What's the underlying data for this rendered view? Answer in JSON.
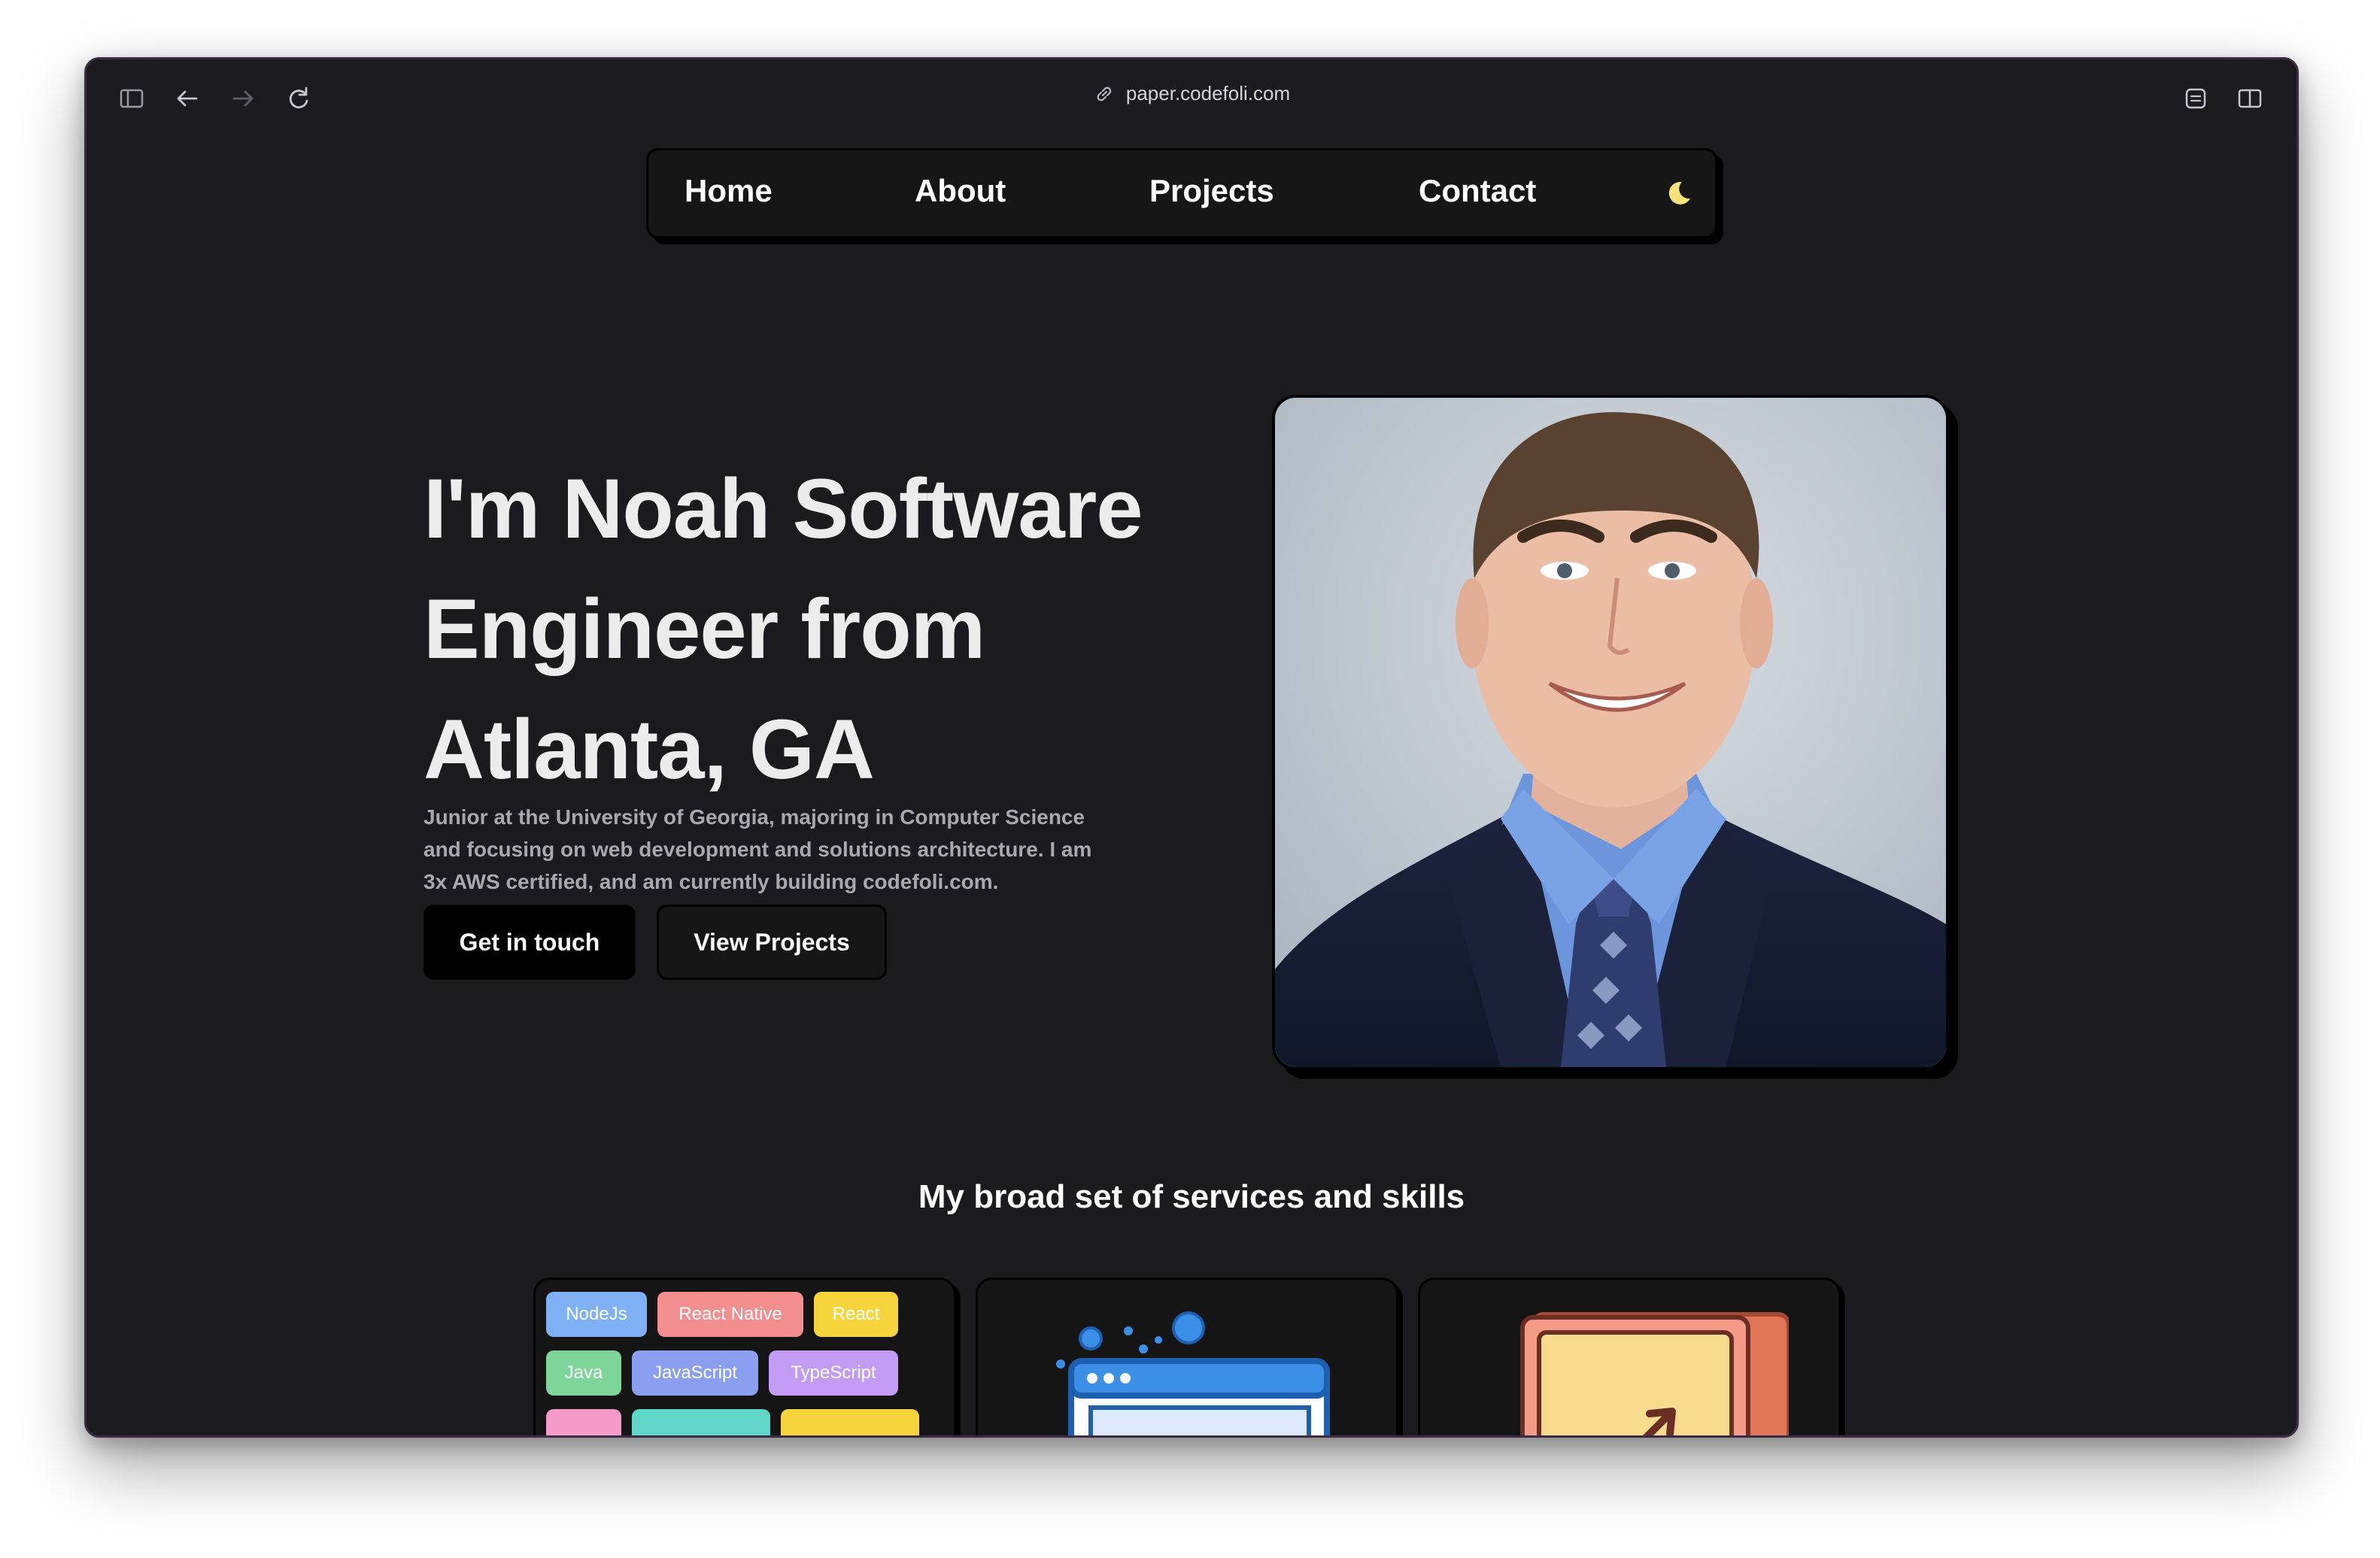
{
  "browser": {
    "url": "paper.codefoli.com"
  },
  "nav": {
    "items": [
      "Home",
      "About",
      "Projects",
      "Contact"
    ],
    "theme_toggle_icon": "moon-icon"
  },
  "hero": {
    "title": "I'm Noah Software Engineer from Atlanta, GA",
    "title_lines": [
      "I'm Noah Software",
      "Engineer from",
      "Atlanta, GA"
    ],
    "description_lines": [
      "Junior at the University of Georgia, majoring in Computer Science",
      "and focusing on web development and solutions architecture. I am",
      "3x AWS certified, and am currently building codefoli.com."
    ],
    "primary_button": "Get in touch",
    "secondary_button": "View Projects"
  },
  "services": {
    "title": "My broad set of services and skills",
    "skill_chips": [
      {
        "label": "NodeJs",
        "color": "#7fb1f4"
      },
      {
        "label": "React Native",
        "color": "#f48f8f"
      },
      {
        "label": "React",
        "color": "#f6d43c"
      },
      {
        "label": "Java",
        "color": "#7ed59a"
      },
      {
        "label": "JavaScript",
        "color": "#8a9ff0"
      },
      {
        "label": "TypeScript",
        "color": "#c19cf2"
      }
    ]
  },
  "colors": {
    "background": "#1b1b1d",
    "accent_moon": "#f6e27a"
  }
}
